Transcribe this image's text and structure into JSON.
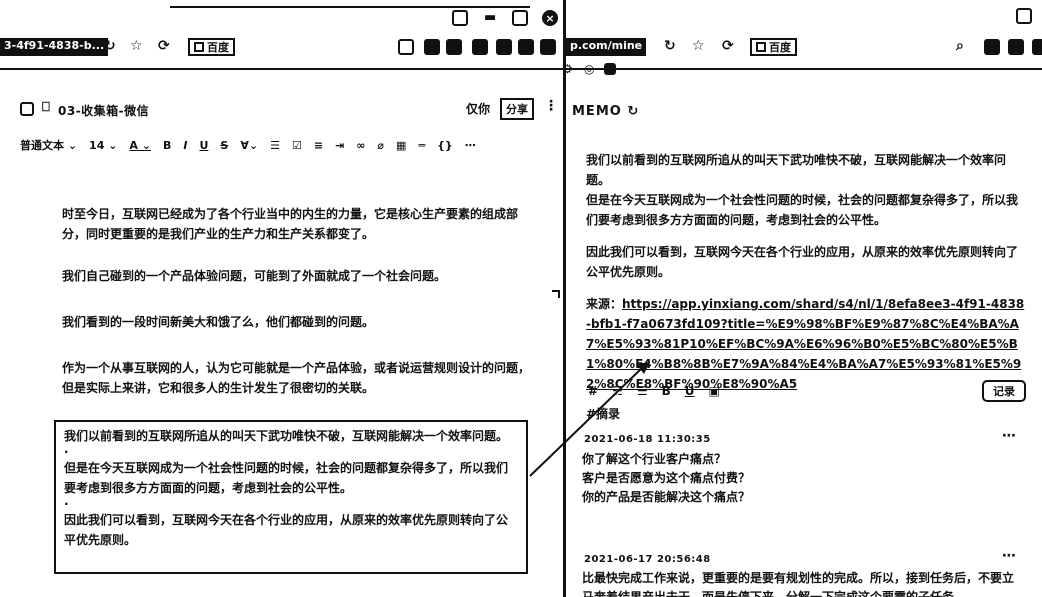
{
  "browser": {
    "left_address_fragment": "3-4f91-4838-b...",
    "right_address_fragment": "p.com/mine",
    "baidu_label": "百度"
  },
  "editor": {
    "doc_title": "03-收集箱-微信",
    "status_label": "仅你",
    "share_label": "分享",
    "more_label": "⋮",
    "toolbar": {
      "style_select": "普通文本",
      "font_size": "14",
      "font_color": "A",
      "bold": "B",
      "italic": "I",
      "underline": "U",
      "strike": "S",
      "highlight": "∀"
    },
    "paragraphs": [
      "时至今日，互联网已经成为了各个行业当中的内生的力量，它是核心生产要素的组成部分，同时更重要的是我们产业的生产力和生产关系都变了。",
      "我们自己碰到的一个产品体验问题，可能到了外面就成了一个社会问题。",
      "我们看到的一段时间新美大和饿了么，他们都碰到的问题。",
      "作为一个从事互联网的人，认为它可能就是一个产品体验，或者说运营规则设计的问题，但是实际上来讲，它和很多人的生计发生了很密切的关联。"
    ],
    "selected_block": [
      "我们以前看到的互联网所追从的叫天下武功唯快不破，互联网能解决一个效率问题。",
      "但是在今天互联网成为一个社会性问题的时候，社会的问题都复杂得多了，所以我们要考虑到很多方方面面的问题，考虑到社会的公平性。",
      "因此我们可以看到，互联网今天在各个行业的应用，从原来的效率优先原则转向了公平优先原则。"
    ]
  },
  "memo": {
    "title": "MEMO",
    "body": [
      "我们以前看到的互联网所追从的叫天下武功唯快不破，互联网能解决一个效率问题。",
      "但是在今天互联网成为一个社会性问题的时候，社会的问题都复杂得多了，所以我们要考虑到很多方方面面的问题，考虑到社会的公平性。",
      "因此我们可以看到，互联网今天在各个行业的应用，从原来的效率优先原则转向了公平优先原则。"
    ],
    "source_label": "来源：",
    "source_url": "https://app.yinxiang.com/shard/s4/nl/1/8efa8ee3-4f91-4838-bfb1-f7a0673fd109?title=%E9%98%BF%E9%87%8C%E4%BA%A7%E5%93%81P10%EF%BC%9A%E6%96%B0%E5%BC%80%E5%B1%80%E4%B8%8B%E7%9A%84%E4%BA%A7%E5%93%81%E5%92%8C%E8%BF%90%E8%90%A5",
    "tag": "#摘录",
    "send_label": "记录",
    "entries": [
      {
        "timestamp": "2021-06-18 11:30:35",
        "lines": [
          "你了解这个行业客户痛点？",
          "客户是否愿意为这个痛点付费？",
          "你的产品是否能解决这个痛点？"
        ]
      },
      {
        "timestamp": "2021-06-17 20:56:48",
        "lines": [
          "比最快完成工作来说，更重要的是要有规划性的完成。所以，接到任务后，不要立马奔着结果产出去干，而是先停下来，分解一下完成这个要需的子任务。"
        ]
      }
    ]
  }
}
